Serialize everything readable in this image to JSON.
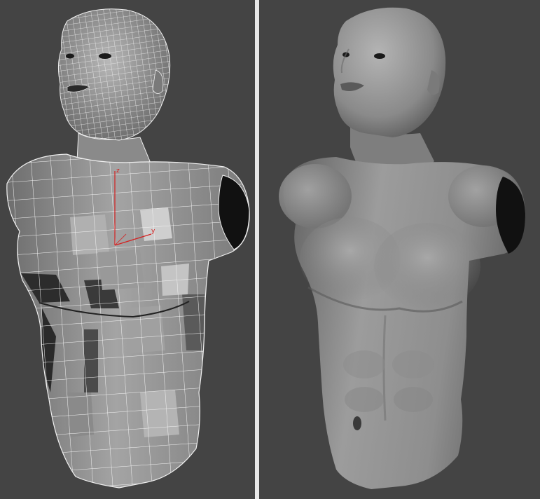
{
  "viewports": {
    "left": {
      "label": "",
      "mode": "wireframe-shaded"
    },
    "right": {
      "label": "",
      "mode": "smooth-shaded"
    }
  },
  "gizmo": {
    "axis_z": "z",
    "axis_y": "y",
    "axis_color": "#d42020"
  },
  "colors": {
    "background": "#444444",
    "divider": "#e8e8e8",
    "mesh_base": "#8c8c8c",
    "wire": "#ffffff"
  }
}
